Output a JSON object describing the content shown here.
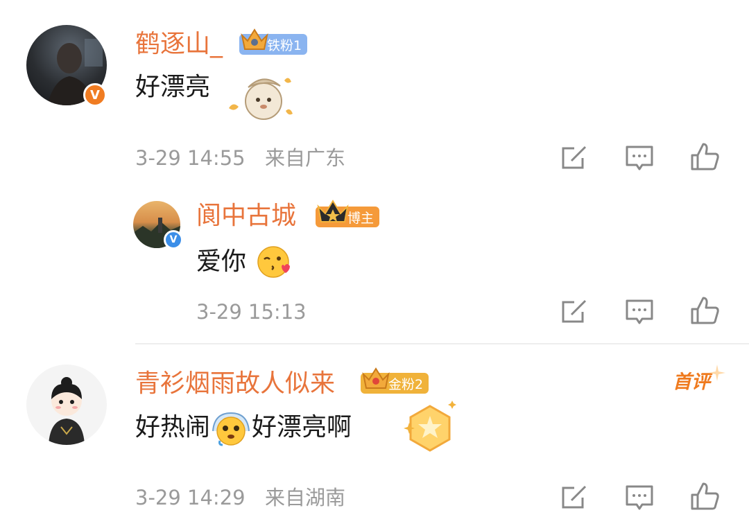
{
  "comments": [
    {
      "username": "鹤逐山_",
      "fan_badge": "铁粉1",
      "text": "好漂亮",
      "time": "3-29 14:55",
      "location": "来自广东",
      "verified": "V"
    },
    {
      "username": "阆中古城",
      "fan_badge": "博主",
      "text": "爱你",
      "time": "3-29 15:13",
      "verified": "V"
    },
    {
      "username": "青衫烟雨故人似来",
      "fan_badge": "金粉2",
      "text_part1": "好热闹",
      "text_part2": "好漂亮啊",
      "time": "3-29 14:29",
      "location": "来自湖南",
      "tag": "首评"
    }
  ],
  "icons": {
    "share": "share-icon",
    "comment": "comment-icon",
    "like": "thumbs-up-icon"
  },
  "colors": {
    "username": "#e8743b",
    "meta": "#9a9a9a",
    "verified_orange": "#f07c22",
    "verified_blue": "#3b8ee8",
    "iron_badge": "#8ab4f0",
    "blogger_badge": "#f59a3a",
    "gold_badge": "#f0b23a"
  }
}
